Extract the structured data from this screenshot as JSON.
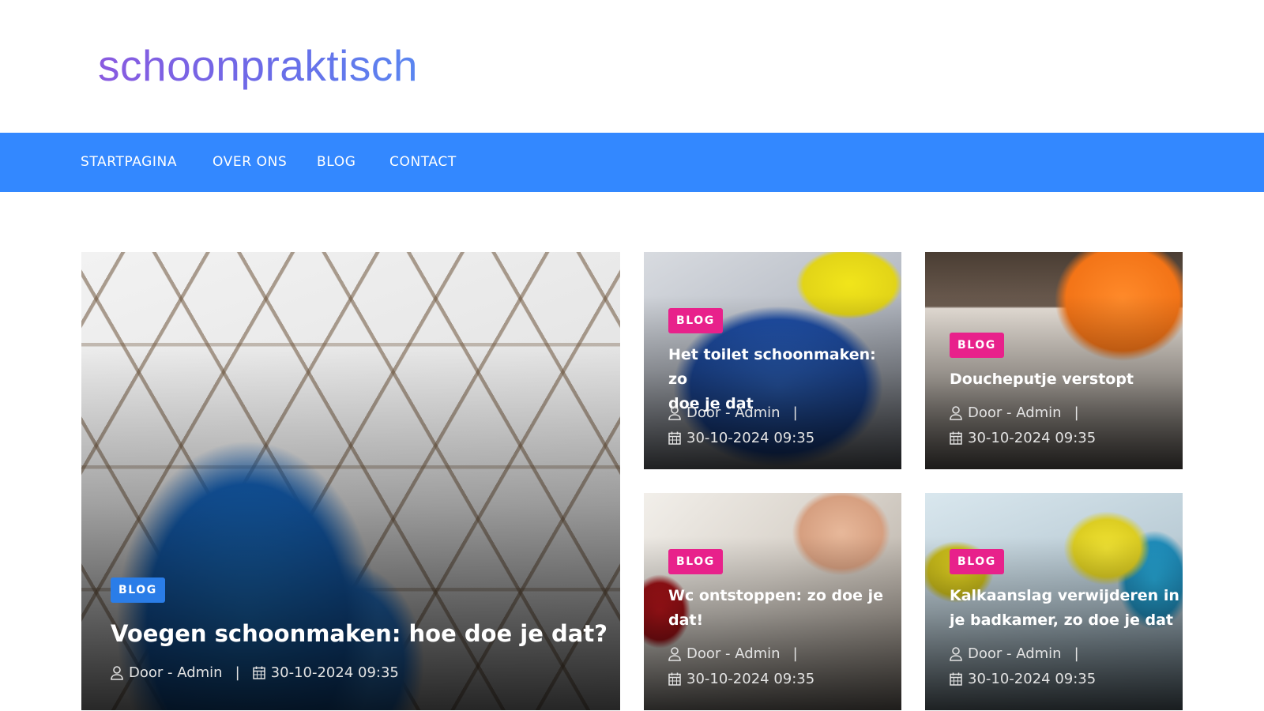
{
  "site": {
    "logo": "schoonpraktisch"
  },
  "nav": {
    "items": [
      "STARTPAGINA",
      "OVER ONS",
      "BLOG",
      "CONTACT"
    ]
  },
  "featured": {
    "category": "BLOG",
    "title": "Voegen schoonmaken: hoe doe je dat?",
    "author": "Door - Admin",
    "date": "30-10-2024 09:35"
  },
  "posts": [
    {
      "category": "BLOG",
      "title_lines": [
        "Het toilet schoonmaken: zo",
        "doe je dat"
      ],
      "author": "Door - Admin",
      "date": "30-10-2024 09:35"
    },
    {
      "category": "BLOG",
      "title_lines": [
        "Doucheputje verstopt"
      ],
      "author": "Door - Admin",
      "date": "30-10-2024 09:35"
    },
    {
      "category": "BLOG",
      "title_lines": [
        "Wc ontstoppen: zo doe je",
        "dat!"
      ],
      "author": "Door - Admin",
      "date": "30-10-2024 09:35"
    },
    {
      "category": "BLOG",
      "title_lines": [
        "Kalkaanslag verwijderen in",
        "je badkamer, zo doe je dat"
      ],
      "author": "Door - Admin",
      "date": "30-10-2024 09:35"
    }
  ],
  "colors": {
    "nav_bg": "#3388ff",
    "badge_pink": "#e8218b",
    "badge_blue": "#2a7de8"
  },
  "icons": {
    "author": "user-icon",
    "date": "calendar-icon"
  }
}
